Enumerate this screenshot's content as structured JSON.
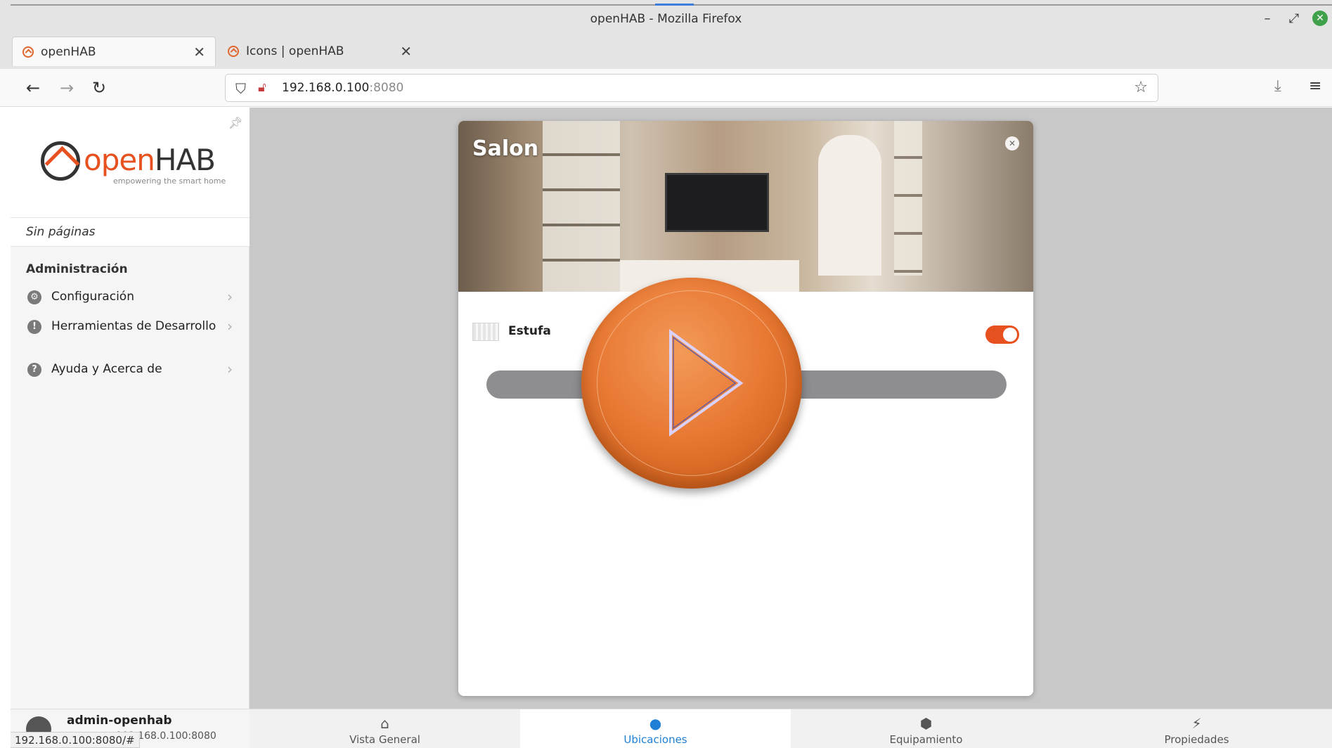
{
  "window": {
    "title": "openHAB - Mozilla Firefox"
  },
  "tabs": [
    {
      "label": "openHAB",
      "active": true
    },
    {
      "label": "Icons | openHAB",
      "active": false
    }
  ],
  "address": {
    "host": "192.168.0.100",
    "port": ":8080"
  },
  "sidebar": {
    "logo_open": "open",
    "logo_hab": "HAB",
    "logo_tagline": "empowering the smart home",
    "no_pages": "Sin páginas",
    "section_title": "Administración",
    "items": [
      {
        "label": "Configuración",
        "icon": "gear-icon"
      },
      {
        "label": "Herramientas de Desarrollo",
        "icon": "shield-icon"
      },
      {
        "label": "Ayuda y Acerca de",
        "icon": "question-icon"
      }
    ],
    "user": {
      "name": "admin-openhab",
      "host": "192.168.0.100:8080"
    }
  },
  "status_bar_url": "192.168.0.100:8080/#",
  "card": {
    "title": "Salon",
    "item_label": "Estufa",
    "toggle_on": true
  },
  "bottom_tabs": [
    {
      "label": "Vista General",
      "icon": "home-icon",
      "active": false
    },
    {
      "label": "Ubicaciones",
      "icon": "location-pin-icon",
      "active": true
    },
    {
      "label": "Equipamiento",
      "icon": "cube-icon",
      "active": false
    },
    {
      "label": "Propiedades",
      "icon": "bolt-icon",
      "active": false
    }
  ],
  "colors": {
    "brand": "#e6511f",
    "active_tab": "#1e7fd6",
    "play_button": "#e87a35"
  }
}
